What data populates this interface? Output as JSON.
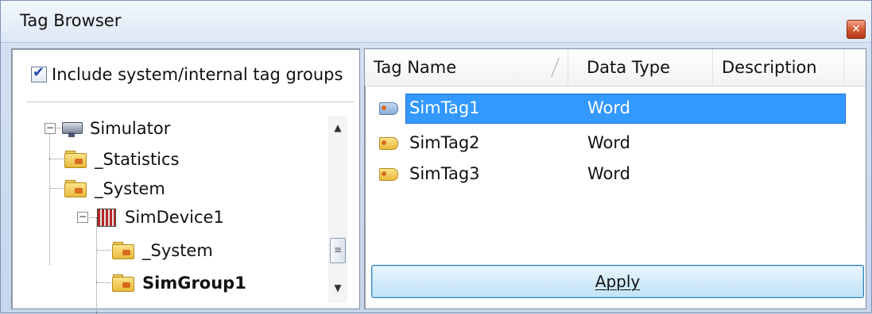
{
  "window": {
    "title": "Tag Browser",
    "close_symbol": "✕"
  },
  "left_pane": {
    "include_system_checkbox": {
      "label": "Include system/internal tag groups",
      "checked": true,
      "check_symbol": "✔"
    },
    "tree": {
      "nodes": [
        {
          "label": "Simulator",
          "icon": "simulator-icon",
          "expander": "−",
          "bold": false
        },
        {
          "label": "_Statistics",
          "icon": "folder-icon",
          "bold": false
        },
        {
          "label": "_System",
          "icon": "folder-icon",
          "bold": false
        },
        {
          "label": "SimDevice1",
          "icon": "device-icon",
          "expander": "−",
          "bold": false
        },
        {
          "label": "_System",
          "icon": "folder-icon",
          "bold": false
        },
        {
          "label": "SimGroup1",
          "icon": "folder-icon",
          "bold": true
        }
      ]
    },
    "scrollbar": {
      "up_arrow": "▲",
      "down_arrow": "▼",
      "thumb_grip": "≡"
    }
  },
  "right_pane": {
    "columns": [
      "Tag Name",
      "Data Type",
      "Description"
    ],
    "rows": [
      {
        "tag_name": "SimTag1",
        "data_type": "Word",
        "description": "",
        "selected": true
      },
      {
        "tag_name": "SimTag2",
        "data_type": "Word",
        "description": "",
        "selected": false
      },
      {
        "tag_name": "SimTag3",
        "data_type": "Word",
        "description": "",
        "selected": false
      }
    ],
    "apply_button": {
      "label": "Apply",
      "mnemonic_char": "A"
    }
  },
  "colors": {
    "selection": "#3399ff",
    "window_background": "#c9d8ec",
    "close_button": "#d2552f"
  }
}
